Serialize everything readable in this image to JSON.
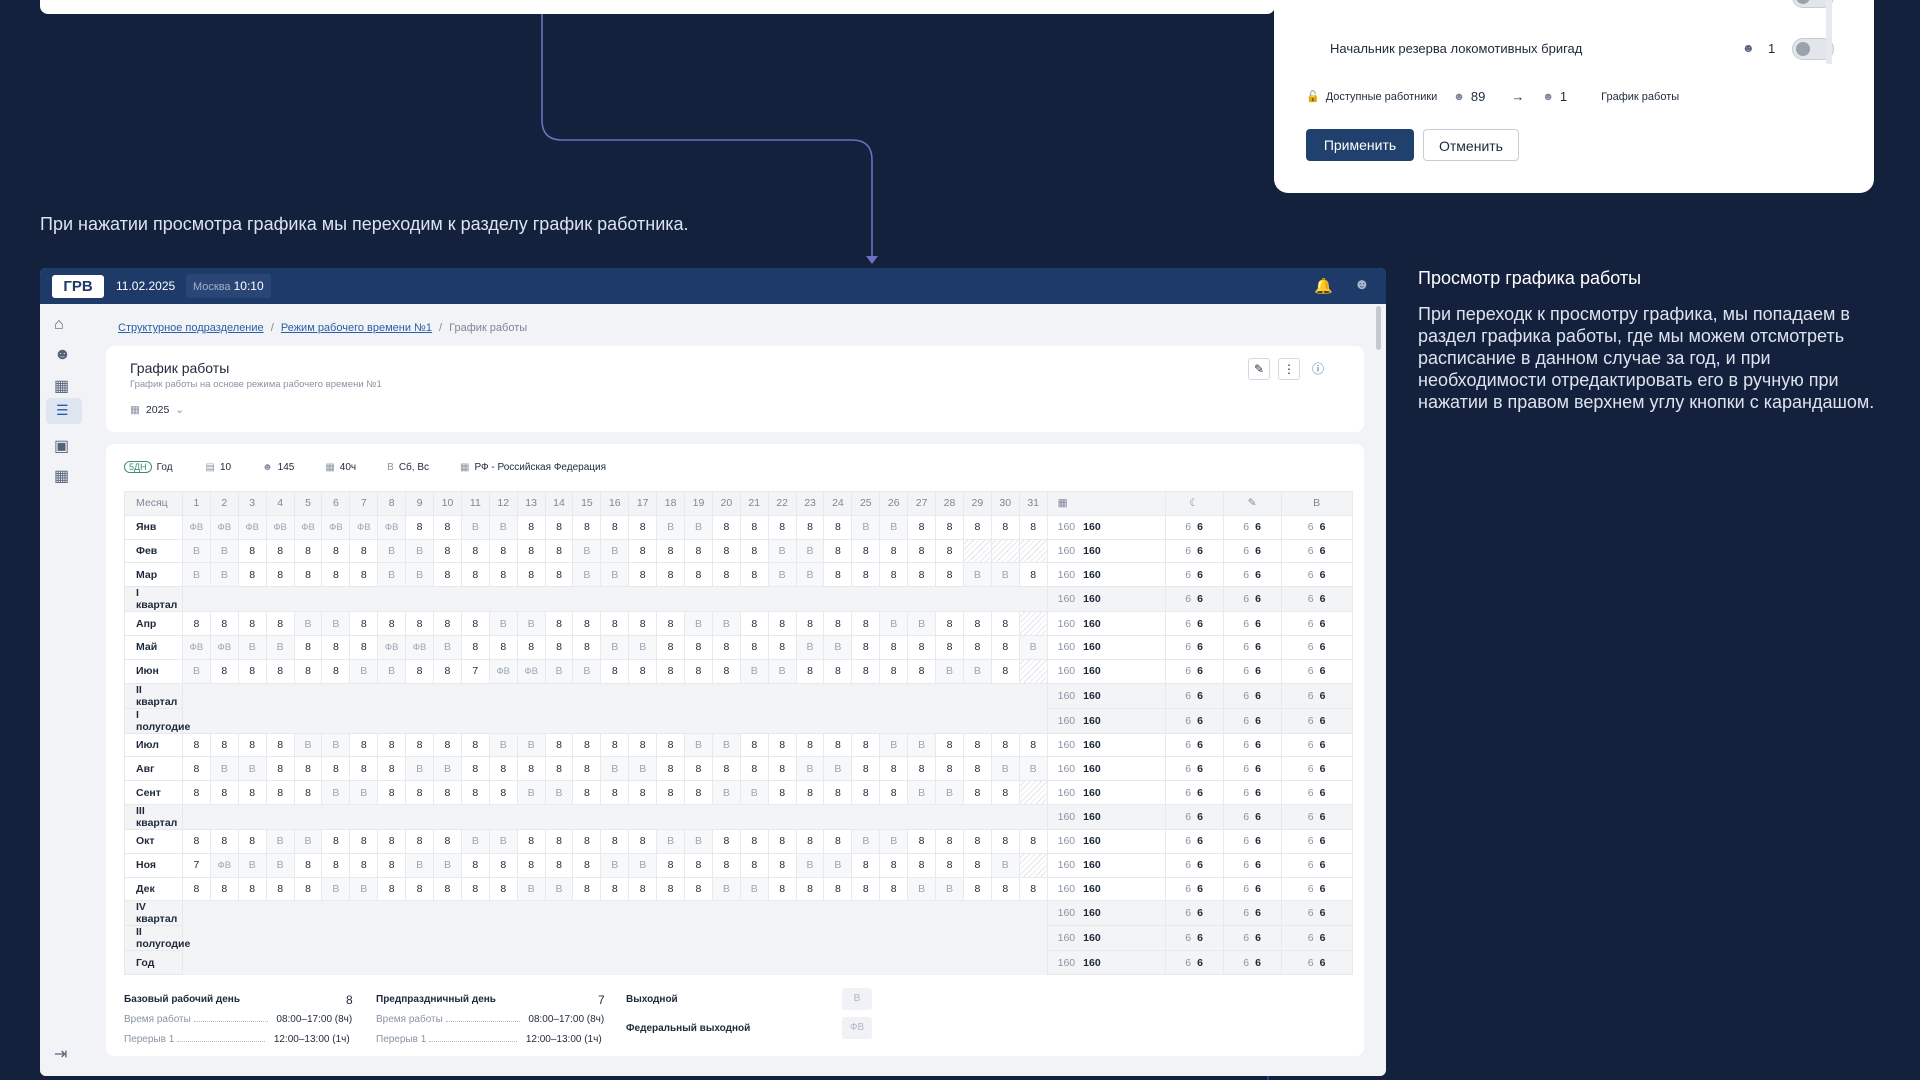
{
  "popup": {
    "row_label": "Начальник резерва локомотивных бригад",
    "row_count": "1",
    "available_label": "Доступные работники",
    "available_count": "89",
    "selected_count": "1",
    "schedule_label": "График работы",
    "apply_label": "Применить",
    "cancel_label": "Отменить"
  },
  "caption_left": "При нажатии просмотра графика мы переходим к разделу график работника.",
  "side_panel": {
    "title": "Просмотр графика работы",
    "text": "При переходк к просмотру графика, мы попадаем в раздел графика работы, где мы можем отсмотреть расписание в данном случае за год, и при необходимости отредактировать его в ручную при нажатии в правом верхнем углу кнопки с карандашом."
  },
  "app": {
    "logo": "ГРВ",
    "date": "11.02.2025",
    "city": "Москва",
    "time": "10:10",
    "breadcrumb": [
      "Структурное подразделение",
      "Режим рабочего времени №1",
      "График работы"
    ],
    "title": "График работы",
    "subtitle": "График работы на основе режима рабочего времени №1",
    "year": "2025",
    "chips": {
      "mode_badge": "5ДН",
      "period": "Год",
      "count1": "10",
      "employees": "145",
      "hours": "40ч",
      "days_off": "Сб, Вс",
      "calendar": "РФ - Российская Федерация"
    },
    "grid": {
      "month_header": "Месяц",
      "days": [
        "1",
        "2",
        "3",
        "4",
        "5",
        "6",
        "7",
        "8",
        "9",
        "10",
        "11",
        "12",
        "13",
        "14",
        "15",
        "16",
        "17",
        "18",
        "19",
        "20",
        "21",
        "22",
        "23",
        "24",
        "25",
        "26",
        "27",
        "28",
        "29",
        "30",
        "31"
      ],
      "last_header": "В",
      "rows": [
        {
          "label": "Янв",
          "cells": [
            "ФВ",
            "ФВ",
            "ФВ",
            "ФВ",
            "ФВ",
            "ФВ",
            "ФВ",
            "ФВ",
            "8",
            "8",
            "В",
            "В",
            "8",
            "8",
            "8",
            "8",
            "8",
            "В",
            "В",
            "8",
            "8",
            "8",
            "8",
            "8",
            "В",
            "В",
            "8",
            "8",
            "8",
            "8",
            "8"
          ]
        },
        {
          "label": "Фев",
          "cells": [
            "В",
            "В",
            "8",
            "8",
            "8",
            "8",
            "8",
            "В",
            "В",
            "8",
            "8",
            "8",
            "8",
            "8",
            "В",
            "В",
            "8",
            "8",
            "8",
            "8",
            "8",
            "В",
            "В",
            "8",
            "8",
            "8",
            "8",
            "8",
            "-",
            "-",
            "-"
          ]
        },
        {
          "label": "Мар",
          "cells": [
            "В",
            "В",
            "8",
            "8",
            "8",
            "8",
            "8",
            "В",
            "В",
            "8",
            "8",
            "8",
            "8",
            "8",
            "В",
            "В",
            "8",
            "8",
            "8",
            "8",
            "8",
            "В",
            "В",
            "8",
            "8",
            "8",
            "8",
            "8",
            "В",
            "В",
            "8"
          ]
        },
        {
          "label": "I квартал",
          "q": true
        },
        {
          "label": "Апр",
          "cells": [
            "8",
            "8",
            "8",
            "8",
            "В",
            "В",
            "8",
            "8",
            "8",
            "8",
            "8",
            "В",
            "В",
            "8",
            "8",
            "8",
            "8",
            "8",
            "В",
            "В",
            "8",
            "8",
            "8",
            "8",
            "8",
            "В",
            "В",
            "8",
            "8",
            "8",
            "-"
          ]
        },
        {
          "label": "Май",
          "cells": [
            "ФВ",
            "ФВ",
            "В",
            "В",
            "8",
            "8",
            "8",
            "ФВ",
            "ФВ",
            "В",
            "8",
            "8",
            "8",
            "8",
            "8",
            "В",
            "В",
            "8",
            "8",
            "8",
            "8",
            "8",
            "В",
            "В",
            "8",
            "8",
            "8",
            "8",
            "8",
            "8",
            "В"
          ]
        },
        {
          "label": "Июн",
          "cells": [
            "В",
            "8",
            "8",
            "8",
            "8",
            "8",
            "В",
            "В",
            "8",
            "8",
            "7",
            "ФВ",
            "ФВ",
            "В",
            "В",
            "8",
            "8",
            "8",
            "8",
            "8",
            "В",
            "В",
            "8",
            "8",
            "8",
            "8",
            "8",
            "В",
            "В",
            "8",
            "-"
          ]
        },
        {
          "label": "II квартал",
          "q": true
        },
        {
          "label": "I полугодие",
          "q": true
        },
        {
          "label": "Июл",
          "cells": [
            "8",
            "8",
            "8",
            "8",
            "В",
            "В",
            "8",
            "8",
            "8",
            "8",
            "8",
            "В",
            "В",
            "8",
            "8",
            "8",
            "8",
            "8",
            "В",
            "В",
            "8",
            "8",
            "8",
            "8",
            "8",
            "В",
            "В",
            "8",
            "8",
            "8",
            "8"
          ]
        },
        {
          "label": "Авг",
          "cells": [
            "8",
            "В",
            "В",
            "8",
            "8",
            "8",
            "8",
            "8",
            "В",
            "В",
            "8",
            "8",
            "8",
            "8",
            "8",
            "В",
            "В",
            "8",
            "8",
            "8",
            "8",
            "8",
            "В",
            "В",
            "8",
            "8",
            "8",
            "8",
            "8",
            "В",
            "В"
          ]
        },
        {
          "label": "Сент",
          "cells": [
            "8",
            "8",
            "8",
            "8",
            "8",
            "В",
            "В",
            "8",
            "8",
            "8",
            "8",
            "8",
            "В",
            "В",
            "8",
            "8",
            "8",
            "8",
            "8",
            "В",
            "В",
            "8",
            "8",
            "8",
            "8",
            "8",
            "В",
            "В",
            "8",
            "8",
            "-"
          ]
        },
        {
          "label": "III квартал",
          "q": true
        },
        {
          "label": "Окт",
          "cells": [
            "8",
            "8",
            "8",
            "В",
            "В",
            "8",
            "8",
            "8",
            "8",
            "8",
            "В",
            "В",
            "8",
            "8",
            "8",
            "8",
            "8",
            "В",
            "В",
            "8",
            "8",
            "8",
            "8",
            "8",
            "В",
            "В",
            "8",
            "8",
            "8",
            "8",
            "8"
          ]
        },
        {
          "label": "Ноя",
          "cells": [
            "7",
            "ФВ",
            "В",
            "В",
            "8",
            "8",
            "8",
            "8",
            "В",
            "В",
            "8",
            "8",
            "8",
            "8",
            "8",
            "В",
            "В",
            "8",
            "8",
            "8",
            "8",
            "8",
            "В",
            "В",
            "8",
            "8",
            "8",
            "8",
            "8",
            "В",
            "-"
          ]
        },
        {
          "label": "Дек",
          "cells": [
            "8",
            "8",
            "8",
            "8",
            "8",
            "В",
            "В",
            "8",
            "8",
            "8",
            "8",
            "8",
            "В",
            "В",
            "8",
            "8",
            "8",
            "8",
            "8",
            "В",
            "В",
            "8",
            "8",
            "8",
            "8",
            "8",
            "В",
            "В",
            "8",
            "8",
            "8"
          ]
        },
        {
          "label": "IV квартал",
          "q": true
        },
        {
          "label": "II полугодие",
          "q": true
        },
        {
          "label": "Год",
          "q": true
        }
      ],
      "total_a": "160",
      "total_b": "160",
      "small_a": "6",
      "small_b": "6"
    },
    "legend": {
      "base_day": "Базовый рабочий день",
      "base_hours": "8",
      "preholiday_day": "Предпраздничный день",
      "preholiday_hours": "7",
      "work_time_label": "Время работы",
      "work_time": "08:00–17:00 (8ч)",
      "break_label": "Перерыв 1",
      "break_time": "12:00–13:00 (1ч)",
      "day_off": "Выходной",
      "day_off_code": "В",
      "fed_day_off": "Федеральный выходной",
      "fed_day_off_code": "ФВ"
    }
  }
}
